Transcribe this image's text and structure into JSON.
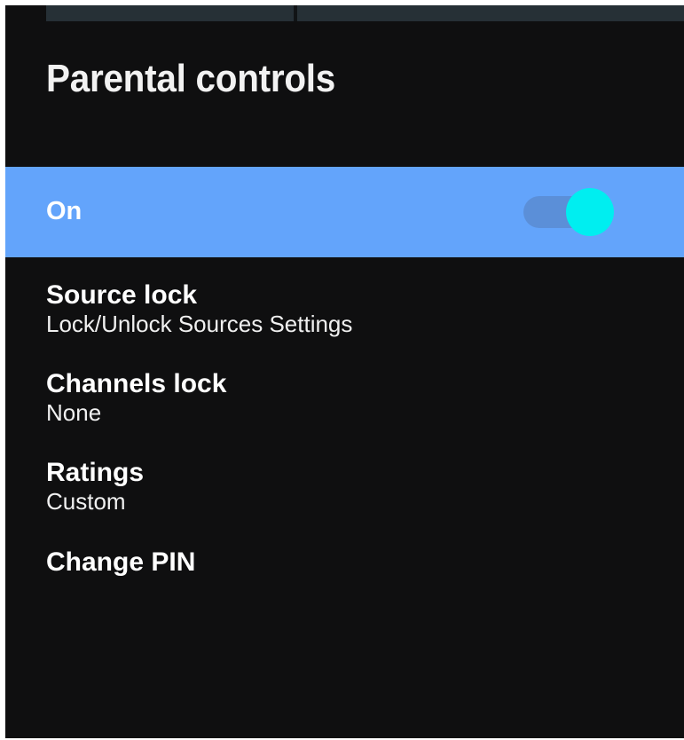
{
  "header": {
    "title": "Parental controls"
  },
  "toggle_row": {
    "label": "On",
    "state": true,
    "colors": {
      "row_background": "#63a4fb",
      "knob": "#00eef0",
      "track": "#5b8fd8"
    }
  },
  "menu": {
    "items": [
      {
        "label": "Source lock",
        "value": "Lock/Unlock Sources Settings"
      },
      {
        "label": "Channels lock",
        "value": "None"
      },
      {
        "label": "Ratings",
        "value": "Custom"
      },
      {
        "label": "Change PIN",
        "value": ""
      }
    ]
  },
  "theme": {
    "background": "#0f0f10",
    "text": "#ffffff"
  }
}
